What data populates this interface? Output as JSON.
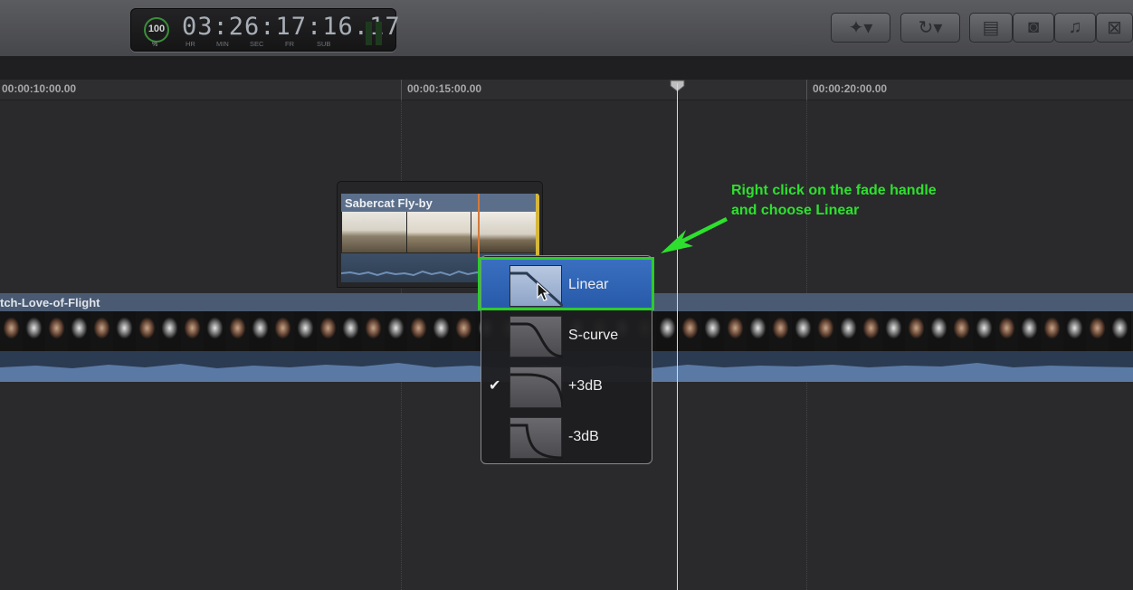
{
  "timecode": {
    "dial_value": "100",
    "dial_unit": "%",
    "digits": "03:26:17:16.17",
    "units": [
      "HR",
      "MIN",
      "SEC",
      "FR",
      "SUB"
    ]
  },
  "toolbar": {
    "buttons": [
      "magic-wand",
      "retime",
      "clip-appearance",
      "photo",
      "music",
      "transitions"
    ]
  },
  "ruler": {
    "labels": [
      "00:00:10:00.00",
      "00:00:15:00.00",
      "00:00:20:00.00"
    ]
  },
  "connected_clip": {
    "title": "Sabercat Fly-by"
  },
  "storyline_clip": {
    "title": "tch-Love-of-Flight"
  },
  "context_menu": {
    "items": [
      {
        "label": "Linear",
        "checked": false,
        "selected": true
      },
      {
        "label": "S-curve",
        "checked": false,
        "selected": false
      },
      {
        "label": "+3dB",
        "checked": true,
        "selected": false
      },
      {
        "label": "-3dB",
        "checked": false,
        "selected": false
      }
    ],
    "checkmark": "✔"
  },
  "annotation": {
    "line1": "Right click on the fade handle",
    "line2": "and choose Linear",
    "color": "#2ee02e"
  }
}
